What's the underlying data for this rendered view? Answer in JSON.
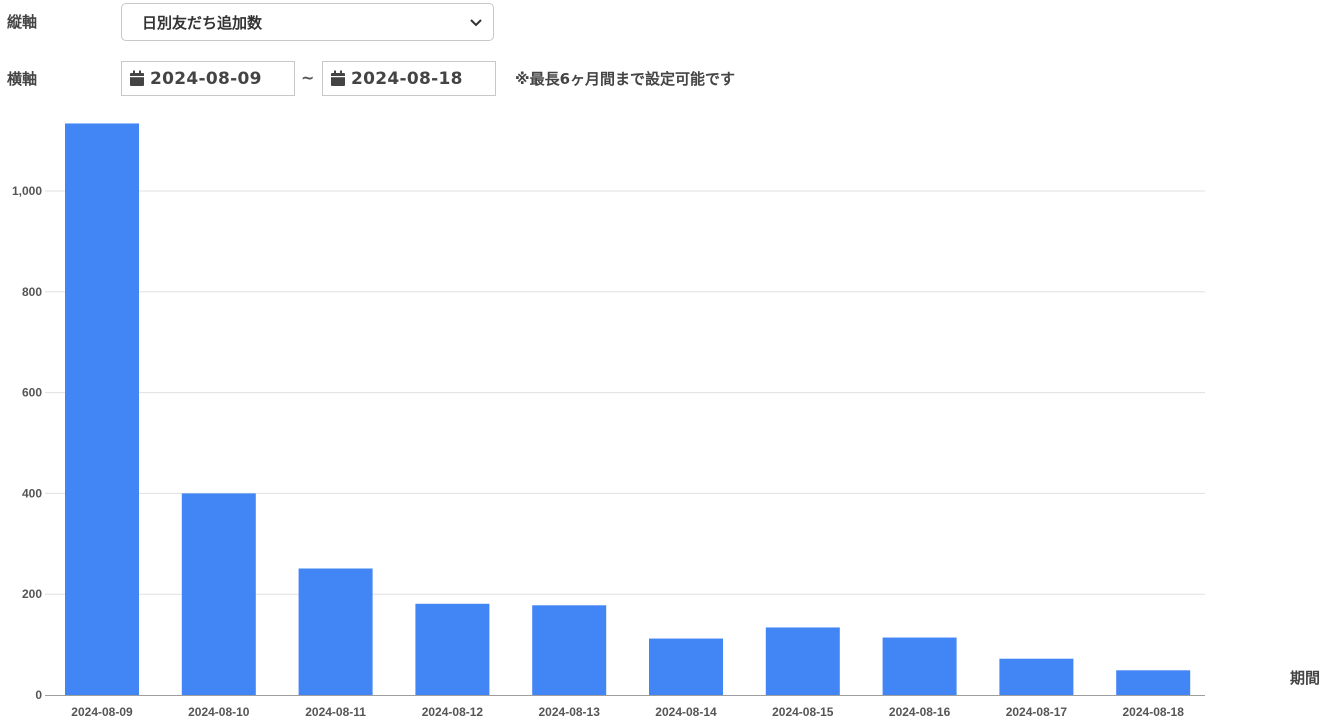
{
  "controls": {
    "vertical_axis_label": "縦軸",
    "vertical_axis_value": "日別友だち追加数",
    "horizontal_axis_label": "横軸",
    "date_from": "2024-08-09",
    "date_separator": "~",
    "date_to": "2024-08-18",
    "range_note": "※最長6ヶ月間まで設定可能です"
  },
  "colors": {
    "bar": "#4285F4",
    "grid": "#e0e0e0",
    "axis": "#9e9e9e"
  },
  "chart_data": {
    "type": "bar",
    "categories": [
      "2024-08-09",
      "2024-08-10",
      "2024-08-11",
      "2024-08-12",
      "2024-08-13",
      "2024-08-14",
      "2024-08-15",
      "2024-08-16",
      "2024-08-17",
      "2024-08-18"
    ],
    "values": [
      1134,
      400,
      251,
      181,
      178,
      112,
      134,
      114,
      72,
      49
    ],
    "xlabel": "期間",
    "ylabel": "",
    "ylim": [
      0,
      1150
    ],
    "yticks": [
      0,
      200,
      400,
      600,
      800,
      1000
    ],
    "ytick_labels": [
      "0",
      "200",
      "400",
      "600",
      "800",
      "1,000"
    ],
    "grid": true
  }
}
